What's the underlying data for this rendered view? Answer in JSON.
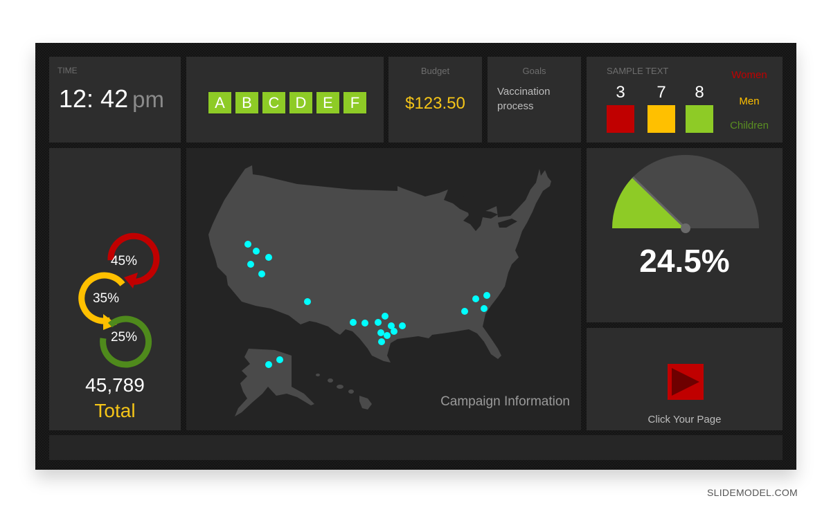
{
  "time_panel": {
    "label": "TIME",
    "time": "12: 42",
    "ampm": "pm"
  },
  "letters_panel": {
    "letters": [
      "A",
      "B",
      "C",
      "D",
      "E",
      "F"
    ],
    "color": "#8ecb26"
  },
  "budget_panel": {
    "label": "Budget",
    "value": "$123.50"
  },
  "goals_panel": {
    "label": "Goals",
    "text": "Vaccination process"
  },
  "sample_panel": {
    "label": "SAMPLE TEXT",
    "counts": [
      {
        "value": "3",
        "color": "#c00000",
        "category": "Women"
      },
      {
        "value": "7",
        "color": "#ffc000",
        "category": "Men"
      },
      {
        "value": "8",
        "color": "#8ecb26",
        "category": "Children"
      }
    ],
    "legend": [
      {
        "label": "Women",
        "color": "#c00000"
      },
      {
        "label": "Men",
        "color": "#ffc000"
      },
      {
        "label": "Children",
        "color": "#5a8e22"
      }
    ]
  },
  "donut_panel": {
    "rings": [
      {
        "label": "45%",
        "value": 45,
        "color": "#c00000"
      },
      {
        "label": "35%",
        "value": 35,
        "color": "#ffc000"
      },
      {
        "label": "25%",
        "value": 25,
        "color": "#4f8a1c"
      }
    ],
    "total_value": "45,789",
    "total_label": "Total"
  },
  "map_panel": {
    "caption": "Campaign Information",
    "marker_color": "#00ffff",
    "markers": [
      {
        "region": "California"
      },
      {
        "region": "California"
      },
      {
        "region": "Nevada"
      },
      {
        "region": "California"
      },
      {
        "region": "California"
      },
      {
        "region": "Arizona"
      },
      {
        "region": "Texas"
      },
      {
        "region": "Texas"
      },
      {
        "region": "Texas"
      },
      {
        "region": "Texas"
      },
      {
        "region": "Texas"
      },
      {
        "region": "Texas"
      },
      {
        "region": "Texas"
      },
      {
        "region": "Texas"
      },
      {
        "region": "Texas"
      },
      {
        "region": "Texas"
      },
      {
        "region": "Georgia"
      },
      {
        "region": "Georgia"
      },
      {
        "region": "South Carolina"
      },
      {
        "region": "Georgia"
      },
      {
        "region": "Alaska"
      },
      {
        "region": "Alaska"
      }
    ]
  },
  "gauge_panel": {
    "value_label": "24.5%",
    "value_fraction": 0.245,
    "fill_color": "#8ecb26",
    "track_color": "#484848"
  },
  "click_panel": {
    "label": "Click Your Page"
  },
  "watermark": "SLIDEMODEL.COM"
}
